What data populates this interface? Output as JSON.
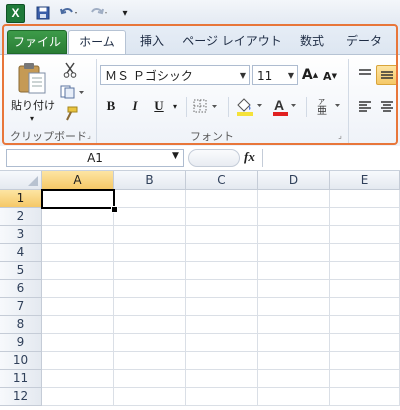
{
  "quick_access": {
    "logo": "X",
    "save_icon": "save-icon",
    "undo_icon": "undo-icon",
    "redo_icon": "redo-icon",
    "customize_icon": "customize-qat-icon"
  },
  "tabs": [
    "ファイル",
    "ホーム",
    "挿入",
    "ページ レイアウト",
    "数式",
    "データ"
  ],
  "ribbon": {
    "clipboard": {
      "paste_label": "貼り付け",
      "group_label": "クリップボード"
    },
    "font": {
      "font_name": "ＭＳ Ｐゴシック",
      "font_size": "11",
      "bold": "B",
      "italic": "I",
      "underline": "U",
      "group_label": "フォント",
      "grow": "A",
      "shrink": "A",
      "font_color": "A"
    }
  },
  "formula_bar": {
    "name_box": "A1",
    "fx": "fx",
    "formula": ""
  },
  "grid": {
    "columns": [
      "A",
      "B",
      "C",
      "D",
      "E"
    ],
    "rows": [
      "1",
      "2",
      "3",
      "4",
      "5",
      "6",
      "7",
      "8",
      "9",
      "10",
      "11",
      "12"
    ],
    "selected_cell": "A1"
  },
  "colors": {
    "accent": "#e8763a",
    "file_tab": "#2a7d36",
    "selection_header": "#f5c867"
  }
}
